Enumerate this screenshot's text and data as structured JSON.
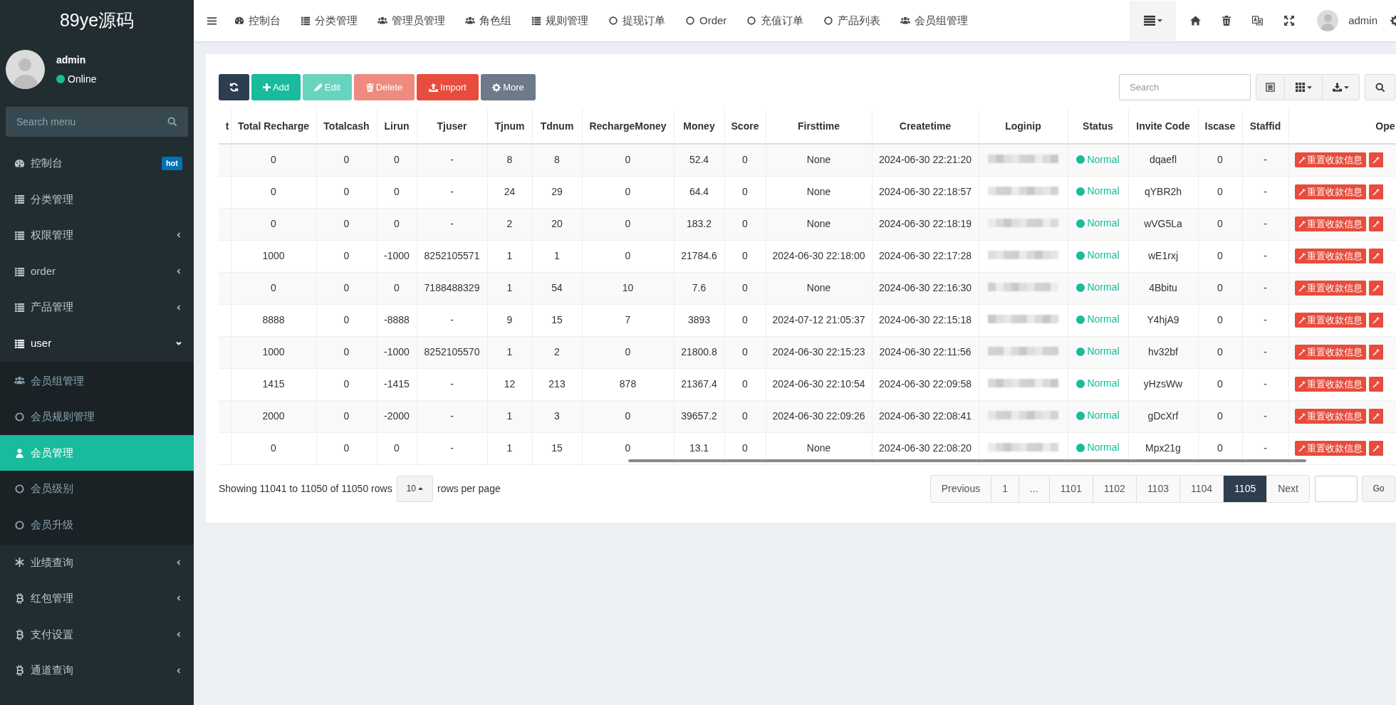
{
  "sidebar": {
    "logo": "89ye源码",
    "user": {
      "name": "admin",
      "status": "Online"
    },
    "search": {
      "placeholder": "Search menu"
    },
    "items": [
      {
        "label": "控制台",
        "kind": "dashboard",
        "badge": "hot"
      },
      {
        "label": "分类管理",
        "kind": "list"
      },
      {
        "label": "权限管理",
        "kind": "list",
        "expanded": false
      },
      {
        "label": "order",
        "kind": "list",
        "expanded": false
      },
      {
        "label": "产品管理",
        "kind": "list",
        "expanded": false
      },
      {
        "label": "user",
        "kind": "list",
        "expanded": true,
        "children": [
          {
            "label": "会员组管理",
            "kind": "users",
            "selected": false
          },
          {
            "label": "会员规则管理",
            "kind": "circle",
            "selected": false
          },
          {
            "label": "会员管理",
            "kind": "user",
            "selected": true
          },
          {
            "label": "会员级别",
            "kind": "circle",
            "selected": false
          },
          {
            "label": "会员升级",
            "kind": "circle",
            "selected": false
          }
        ]
      },
      {
        "label": "业绩查询",
        "kind": "asterisk",
        "expanded": false
      },
      {
        "label": "红包管理",
        "kind": "bitcoin",
        "expanded": false
      },
      {
        "label": "支付设置",
        "kind": "bitcoin",
        "expanded": false
      },
      {
        "label": "通道查询",
        "kind": "bitcoin",
        "expanded": false
      }
    ]
  },
  "topbar": {
    "nav": [
      {
        "label": "控制台",
        "kind": "dashboard"
      },
      {
        "label": "分类管理",
        "kind": "list"
      },
      {
        "label": "管理员管理",
        "kind": "users"
      },
      {
        "label": "角色组",
        "kind": "users"
      },
      {
        "label": "规则管理",
        "kind": "list"
      },
      {
        "label": "提现订单",
        "kind": "circle"
      },
      {
        "label": "Order",
        "kind": "circle"
      },
      {
        "label": "充值订单",
        "kind": "circle"
      },
      {
        "label": "产品列表",
        "kind": "circle"
      },
      {
        "label": "会员组管理",
        "kind": "users"
      }
    ],
    "user": "admin"
  },
  "toolbar": {
    "buttons": [
      {
        "kind": "refresh",
        "disabled": false
      },
      {
        "kind": "add",
        "label": "Add",
        "disabled": false
      },
      {
        "kind": "edit",
        "label": "Edit",
        "disabled": true
      },
      {
        "kind": "delete",
        "label": "Delete",
        "disabled": true
      },
      {
        "kind": "import",
        "label": "Import",
        "disabled": false
      },
      {
        "kind": "more",
        "label": "More",
        "disabled": false
      }
    ],
    "search": {
      "placeholder": "Search"
    }
  },
  "table": {
    "columns": [
      {
        "label": "t",
        "kind": "empty"
      },
      {
        "label": "Total Recharge",
        "kind": "text"
      },
      {
        "label": "Totalcash",
        "kind": "text"
      },
      {
        "label": "Lirun",
        "kind": "text"
      },
      {
        "label": "Tjuser",
        "kind": "text"
      },
      {
        "label": "Tjnum",
        "kind": "text"
      },
      {
        "label": "Tdnum",
        "kind": "text"
      },
      {
        "label": "RechargeMoney",
        "kind": "text"
      },
      {
        "label": "Money",
        "kind": "text"
      },
      {
        "label": "Score",
        "kind": "text"
      },
      {
        "label": "Firsttime",
        "kind": "text"
      },
      {
        "label": "Createtime",
        "kind": "text"
      },
      {
        "label": "Loginip",
        "kind": "blurred"
      },
      {
        "label": "Status",
        "kind": "status"
      },
      {
        "label": "Invite Code",
        "kind": "text"
      },
      {
        "label": "Iscase",
        "kind": "text"
      },
      {
        "label": "Staffid",
        "kind": "text"
      },
      {
        "label": "Ope",
        "kind": "actions"
      }
    ],
    "rows": [
      {
        "cells": [
          "",
          "0",
          "0",
          "0",
          "-",
          "8",
          "8",
          "0",
          "52.4",
          "0",
          "None",
          "2024-06-30 22:21:20",
          "",
          "Normal",
          "dqaefl",
          "0",
          "-",
          "重置收款信息"
        ]
      },
      {
        "cells": [
          "",
          "0",
          "0",
          "0",
          "-",
          "24",
          "29",
          "0",
          "64.4",
          "0",
          "None",
          "2024-06-30 22:18:57",
          "",
          "Normal",
          "qYBR2h",
          "0",
          "-",
          "重置收款信息"
        ]
      },
      {
        "cells": [
          "",
          "0",
          "0",
          "0",
          "-",
          "2",
          "20",
          "0",
          "183.2",
          "0",
          "None",
          "2024-06-30 22:18:19",
          "",
          "Normal",
          "wVG5La",
          "0",
          "-",
          "重置收款信息"
        ]
      },
      {
        "cells": [
          "",
          "1000",
          "0",
          "-1000",
          "8252105571",
          "1",
          "1",
          "0",
          "21784.6",
          "0",
          "2024-06-30 22:18:00",
          "2024-06-30 22:17:28",
          "",
          "Normal",
          "wE1rxj",
          "0",
          "-",
          "重置收款信息"
        ]
      },
      {
        "cells": [
          "",
          "0",
          "0",
          "0",
          "7188488329",
          "1",
          "54",
          "10",
          "7.6",
          "0",
          "None",
          "2024-06-30 22:16:30",
          "",
          "Normal",
          "4Bbitu",
          "0",
          "-",
          "重置收款信息"
        ]
      },
      {
        "cells": [
          "",
          "8888",
          "0",
          "-8888",
          "-",
          "9",
          "15",
          "7",
          "3893",
          "0",
          "2024-07-12 21:05:37",
          "2024-06-30 22:15:18",
          "",
          "Normal",
          "Y4hjA9",
          "0",
          "-",
          "重置收款信息"
        ]
      },
      {
        "cells": [
          "",
          "1000",
          "0",
          "-1000",
          "8252105570",
          "1",
          "2",
          "0",
          "21800.8",
          "0",
          "2024-06-30 22:15:23",
          "2024-06-30 22:11:56",
          "",
          "Normal",
          "hv32bf",
          "0",
          "-",
          "重置收款信息"
        ]
      },
      {
        "cells": [
          "",
          "1415",
          "0",
          "-1415",
          "-",
          "12",
          "213",
          "878",
          "21367.4",
          "0",
          "2024-06-30 22:10:54",
          "2024-06-30 22:09:58",
          "",
          "Normal",
          "yHzsWw",
          "0",
          "-",
          "重置收款信息"
        ]
      },
      {
        "cells": [
          "",
          "2000",
          "0",
          "-2000",
          "-",
          "1",
          "3",
          "0",
          "39657.2",
          "0",
          "2024-06-30 22:09:26",
          "2024-06-30 22:08:41",
          "",
          "Normal",
          "gDcXrf",
          "0",
          "-",
          "重置收款信息"
        ]
      },
      {
        "cells": [
          "",
          "0",
          "0",
          "0",
          "-",
          "1",
          "15",
          "0",
          "13.1",
          "0",
          "None",
          "2024-06-30 22:08:20",
          "",
          "Normal",
          "Mpx21g",
          "0",
          "-",
          "重置收款信息"
        ]
      }
    ]
  },
  "footer": {
    "summary": "Showing 11041 to 11050 of 11050 rows",
    "page_size": "10",
    "per_page_label": "rows per page",
    "pages": [
      {
        "label": "Previous",
        "selected": false
      },
      {
        "label": "1",
        "selected": false
      },
      {
        "label": "...",
        "selected": false
      },
      {
        "label": "1101",
        "selected": false
      },
      {
        "label": "1102",
        "selected": false
      },
      {
        "label": "1103",
        "selected": false
      },
      {
        "label": "1104",
        "selected": false
      },
      {
        "label": "1105",
        "selected": true
      },
      {
        "label": "Next",
        "selected": false
      }
    ],
    "go": "Go"
  }
}
